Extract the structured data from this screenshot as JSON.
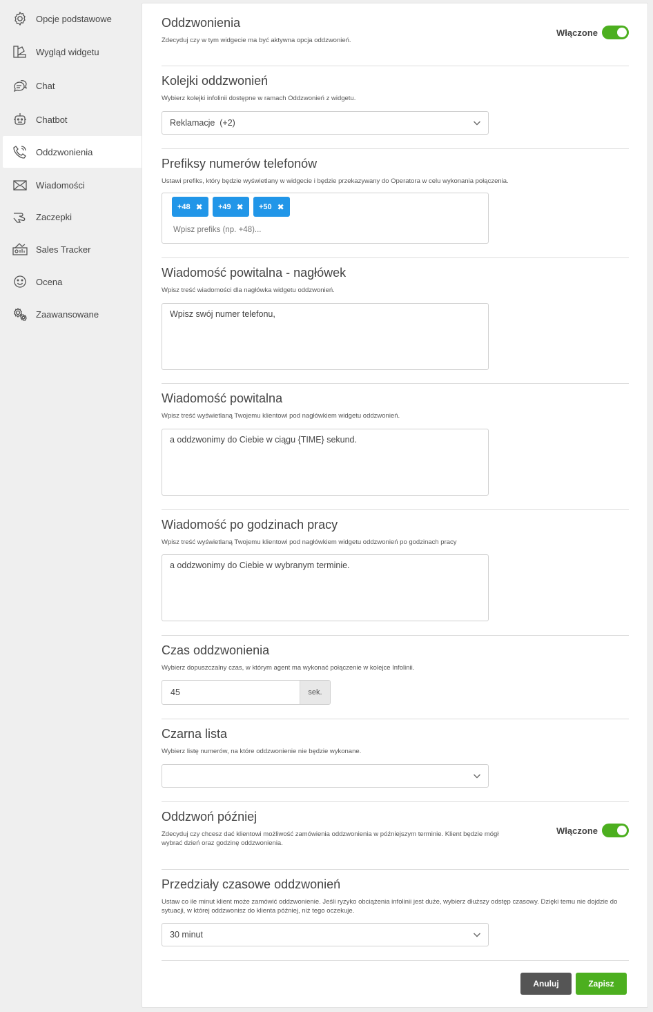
{
  "sidebar": {
    "items": [
      {
        "label": "Opcje podstawowe",
        "icon": "gear-icon"
      },
      {
        "label": "Wygląd widgetu",
        "icon": "palette-icon"
      },
      {
        "label": "Chat",
        "icon": "chat-bubbles-icon"
      },
      {
        "label": "Chatbot",
        "icon": "robot-icon"
      },
      {
        "label": "Oddzwonienia",
        "icon": "phone-callback-icon"
      },
      {
        "label": "Wiadomości",
        "icon": "envelope-icon"
      },
      {
        "label": "Zaczepki",
        "icon": "hand-icon"
      },
      {
        "label": "Sales Tracker",
        "icon": "sales-tracker-icon"
      },
      {
        "label": "Ocena",
        "icon": "smiley-icon"
      },
      {
        "label": "Zaawansowane",
        "icon": "gears-icon"
      }
    ],
    "active_index": 4
  },
  "sections": {
    "callbacks": {
      "title": "Oddzwonienia",
      "desc": "Zdecyduj czy w tym widgecie ma być aktywna opcja oddzwonień.",
      "toggle_label": "Włączone"
    },
    "queues": {
      "title": "Kolejki oddzwonień",
      "desc": "Wybierz kolejki infolinii dostępne w ramach Oddzwonień z widgetu.",
      "value": "Reklamacje  (+2)"
    },
    "prefixes": {
      "title": "Prefiksy numerów telefonów",
      "desc": "Ustawi prefiks, który będzie wyświetlany w widgecie i będzie przekazywany do Operatora w celu wykonania połączenia.",
      "tags": [
        "+48",
        "+49",
        "+50"
      ],
      "placeholder": "Wpisz prefiks (np. +48)..."
    },
    "welcome_header": {
      "title": "Wiadomość powitalna - nagłówek",
      "desc": "Wpisz treść wiadomości dla nagłówka widgetu oddzwonień.",
      "value": "Wpisz swój numer telefonu,"
    },
    "welcome": {
      "title": "Wiadomość powitalna",
      "desc": "Wpisz treść wyświetlaną Twojemu klientowi pod nagłówkiem widgetu oddzwonień.",
      "value": "a oddzwonimy do Ciebie w ciągu {TIME} sekund."
    },
    "after_hours": {
      "title": "Wiadomość po godzinach pracy",
      "desc": "Wpisz treść wyświetlaną Twojemu klientowi pod nagłówkiem widgetu oddzwonień po godzinach pracy",
      "value": "a oddzwonimy do Ciebie w wybranym terminie."
    },
    "callback_time": {
      "title": "Czas oddzwonienia",
      "desc": "Wybierz dopuszczalny czas, w którym agent ma wykonać połączenie w kolejce Infolinii.",
      "value": "45",
      "unit": "sek."
    },
    "blacklist": {
      "title": "Czarna lista",
      "desc": "Wybierz listę numerów, na które oddzwonienie nie będzie wykonane.",
      "value": ""
    },
    "call_later": {
      "title": "Oddzwoń później",
      "desc": "Zdecyduj czy chcesz dać klientowi możliwość zamówienia oddzwonienia w późniejszym terminie. Klient będzie mógł wybrać dzień oraz godzinę oddzwonienia.",
      "toggle_label": "Włączone"
    },
    "intervals": {
      "title": "Przedziały czasowe oddzwonień",
      "desc": "Ustaw co ile minut klient może zamówić oddzwonienie. Jeśli ryzyko obciążenia infolinii jest duże, wybierz dłuższy odstęp czasowy. Dzięki temu nie dojdzie do sytuacji, w której oddzwonisz do klienta później, niż tego oczekuje.",
      "value": "30 minut"
    }
  },
  "actions": {
    "cancel_label": "Anuluj",
    "save_label": "Zapisz"
  },
  "colors": {
    "toggle_on": "#4caf1f",
    "tag_blue": "#2196e8",
    "cancel_bg": "#555555",
    "save_bg": "#4caf1f"
  }
}
